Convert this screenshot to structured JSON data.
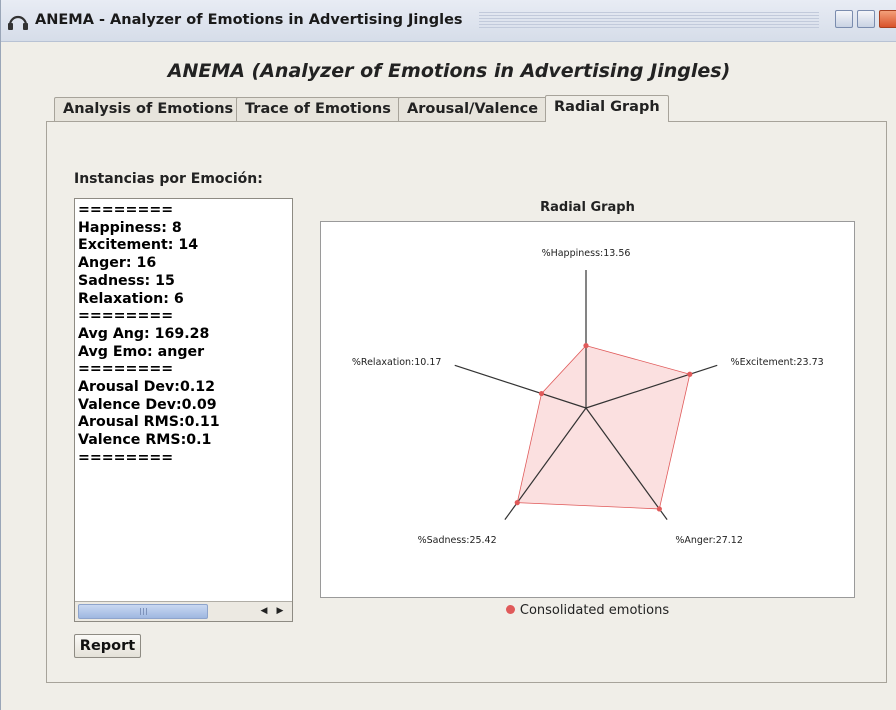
{
  "window": {
    "title": "ANEMA - Analyzer of Emotions in Advertising Jingles",
    "icon": "headphones-icon"
  },
  "heading": "ANEMA (Analyzer of Emotions in Advertising Jingles)",
  "tabs": [
    {
      "label": "Analysis of Emotions",
      "active": false
    },
    {
      "label": "Trace of Emotions",
      "active": false
    },
    {
      "label": "Arousal/Valence",
      "active": false
    },
    {
      "label": "Radial Graph",
      "active": true
    }
  ],
  "left_panel": {
    "label": "Instancias por Emoción:",
    "stats_text": "========\nHappiness: 8\nExcitement: 14\nAnger: 16\nSadness: 15\nRelaxation: 6\n========\nAvg Ang: 169.28\nAvg Emo: anger\n========\nArousal Dev:0.12\nValence Dev:0.09\nArousal RMS:0.11\nValence RMS:0.1\n========",
    "report_button": "Report"
  },
  "chart_data": {
    "type": "radar",
    "title": "Radial Graph",
    "axes": [
      "%Happiness:13.56",
      "%Excitement:23.73",
      "%Anger:27.12",
      "%Sadness:25.42",
      "%Relaxation:10.17"
    ],
    "series": [
      {
        "name": "Consolidated emotions",
        "values": [
          13.56,
          23.73,
          27.12,
          25.42,
          10.17
        ],
        "color": "#e05a5a",
        "fill": "#f9d6d6"
      }
    ],
    "max_value": 30
  },
  "colors": {
    "accent": "#e05a5a"
  }
}
